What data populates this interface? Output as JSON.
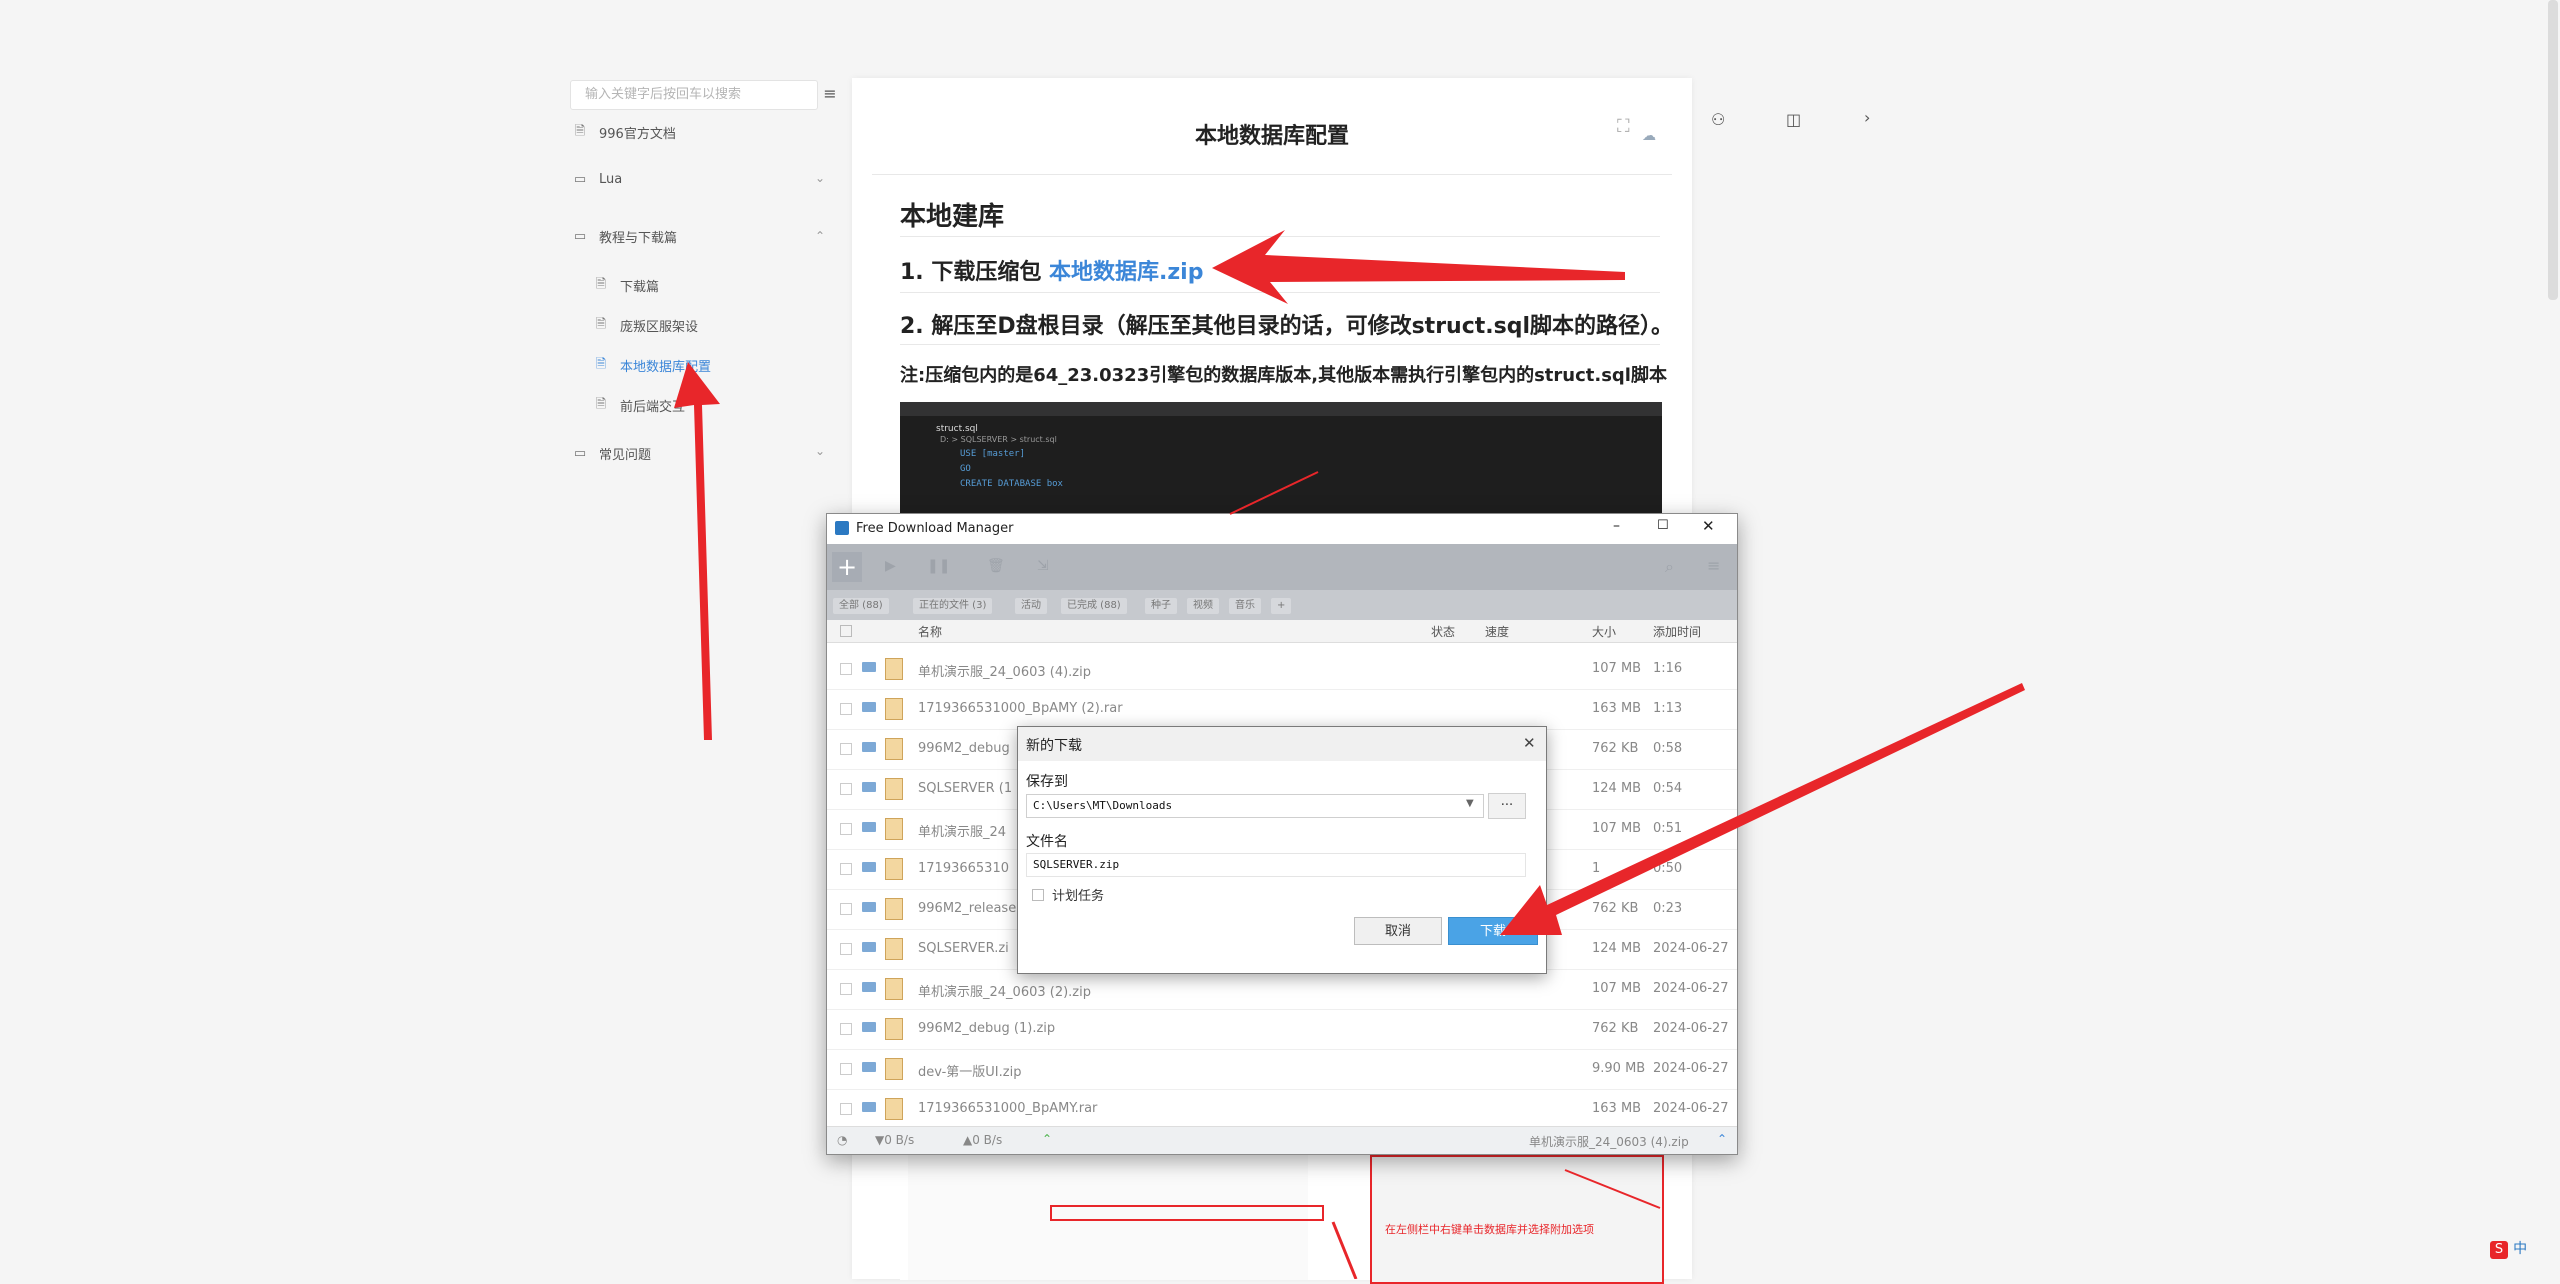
{
  "sidebar": {
    "search_placeholder": "输入关键字后按回车以搜索",
    "items": [
      {
        "label": "996官方文档",
        "type": "doc"
      },
      {
        "label": "Lua",
        "type": "folder"
      },
      {
        "label": "教程与下载篇",
        "type": "folder"
      },
      {
        "label": "下载篇",
        "type": "doc"
      },
      {
        "label": "庞叛区服架设",
        "type": "doc"
      },
      {
        "label": "本地数据库配置",
        "type": "doc",
        "active": true
      },
      {
        "label": "前后端交互",
        "type": "doc"
      },
      {
        "label": "常见问题",
        "type": "folder"
      }
    ]
  },
  "doc": {
    "title": "本地数据库配置",
    "h1": "本地建库",
    "step1_prefix": "1. 下载压缩包 ",
    "step1_link": "本地数据库.zip",
    "step2": "2. 解压至D盘根目录（解压至其他目录的话，可修改struct.sql脚本的路径）。",
    "note": "注:压缩包内的是64_23.0323引擎包的数据库版本,其他版本需执行引擎包内的struct.sql脚本",
    "vscode_tab": "struct.sql",
    "vscode_breadcrumb": "D: > SQLSERVER > struct.sql",
    "vscode_code": [
      "USE [master]",
      "GO",
      "",
      "",
      "CREATE DATABASE box"
    ],
    "bottom_caption": "在左侧栏中右键单击数据库并选择附加选项"
  },
  "fdm": {
    "title": "Free Download Manager",
    "filters": [
      "全部 (88)",
      "正在的文件 (3)",
      "活动",
      "已完成 (88)",
      "种子",
      "视频",
      "音乐"
    ],
    "columns": {
      "name": "名称",
      "status": "状态",
      "speed": "速度",
      "size": "大小",
      "added": "添加时间"
    },
    "rows": [
      {
        "name": "单机演示服_24_0603 (4).zip",
        "size": "107 MB",
        "added": "1:16"
      },
      {
        "name": "1719366531000_BpAMY (2).rar",
        "size": "163 MB",
        "added": "1:13"
      },
      {
        "name": "996M2_debug",
        "size": "762 KB",
        "added": "0:58"
      },
      {
        "name": "SQLSERVER (1",
        "size": "124 MB",
        "added": "0:54"
      },
      {
        "name": "单机演示服_24",
        "size": "107 MB",
        "added": "0:51"
      },
      {
        "name": "17193665310",
        "size": "1",
        "added": "0:50"
      },
      {
        "name": "996M2_release",
        "size": "762 KB",
        "added": "0:23"
      },
      {
        "name": "SQLSERVER.zi",
        "size": "124 MB",
        "added": "2024-06-27"
      },
      {
        "name": "单机演示服_24_0603 (2).zip",
        "size": "107 MB",
        "added": "2024-06-27"
      },
      {
        "name": "996M2_debug (1).zip",
        "size": "762 KB",
        "added": "2024-06-27"
      },
      {
        "name": "dev-第一版UI.zip",
        "size": "9.90 MB",
        "added": "2024-06-27"
      },
      {
        "name": "1719366531000_BpAMY.rar",
        "size": "163 MB",
        "added": "2024-06-27"
      }
    ],
    "status_down": "▼0 B/s",
    "status_up": "▲0 B/s",
    "status_file": "单机演示服_24_0603 (4).zip"
  },
  "dialog": {
    "title": "新的下载",
    "save_to_label": "保存到",
    "save_path": "C:\\Users\\MT\\Downloads",
    "filename_label": "文件名",
    "filename": "SQLSERVER.zip",
    "schedule_label": "计划任务",
    "cancel": "取消",
    "download": "下载"
  },
  "ime": {
    "label": "中"
  },
  "colors": {
    "accent": "#3b86d8",
    "arrow": "#e8262a",
    "download_button": "#4aa3e6"
  }
}
